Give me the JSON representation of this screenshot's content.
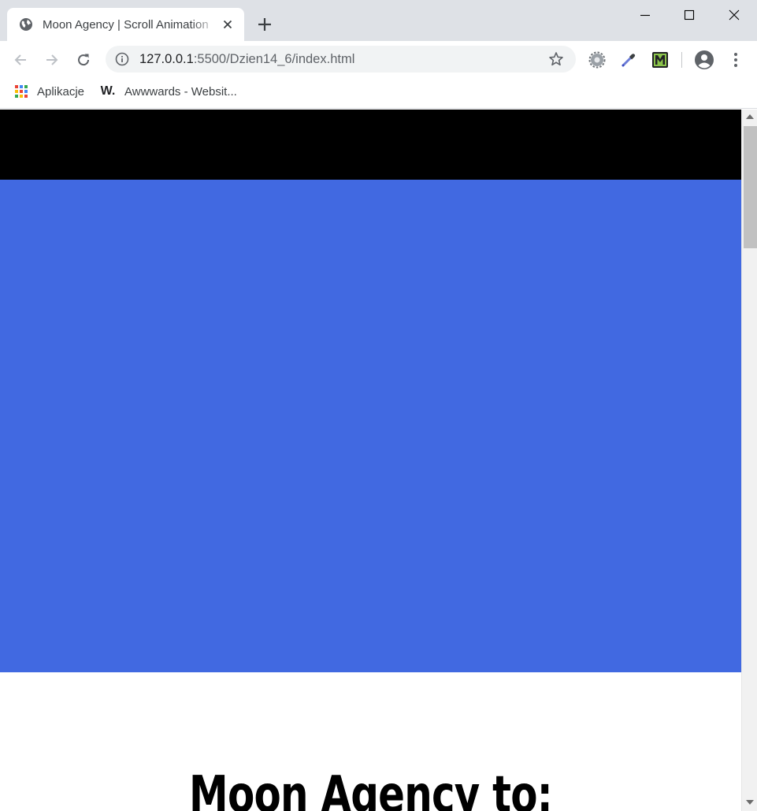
{
  "browser": {
    "tab": {
      "title": "Moon Agency | Scroll Animation",
      "favicon": "globe-icon",
      "close_icon": "close-icon"
    },
    "new_tab_icon": "plus-icon",
    "window_controls": [
      "minimize-icon",
      "maximize-icon",
      "close-icon"
    ],
    "toolbar": {
      "back_icon": "arrow-left-icon",
      "forward_icon": "arrow-right-icon",
      "reload_icon": "reload-icon",
      "url_host": "127.0.0.1",
      "url_rest": ":5500/Dzien14_6/index.html",
      "site_info_icon": "info-icon",
      "bookmark_star_icon": "star-icon",
      "extensions": [
        "gear-extension-icon",
        "eyedropper-extension-icon",
        "m-extension-icon"
      ],
      "profile_icon": "account-icon",
      "menu_icon": "more-vert-icon"
    },
    "bookmarks": [
      {
        "label": "Aplikacje",
        "icon": "apps-grid-icon"
      },
      {
        "label": "Awwwards - Websit...",
        "icon": "awwwards-w-icon"
      }
    ]
  },
  "page": {
    "header_color": "#000000",
    "hero_color": "#4169e1",
    "headline": "Moon Agency to:"
  }
}
